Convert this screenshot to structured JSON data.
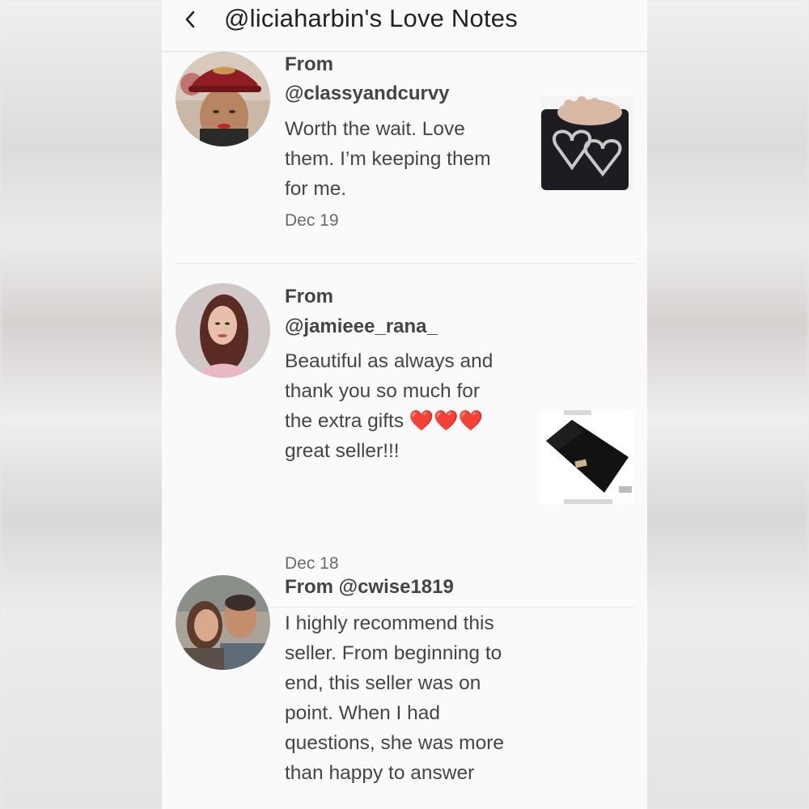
{
  "header": {
    "title": "@liciaharbin's Love Notes",
    "back_icon": "chevron-left-icon"
  },
  "notes": [
    {
      "from_label": "From",
      "username": "@classyandcurvy",
      "text": "Worth the wait. Love them. I’m keeping them for me.",
      "date": "Dec 19",
      "thumbnail": "gloves-with-chain-hearts"
    },
    {
      "from_label": "From",
      "username": "@jamieee_rana_",
      "text": "Beautiful as always and thank you so much for the extra gifts ❤️❤️❤️ great seller!!!",
      "date": "Dec 18",
      "thumbnail": "black-pouch"
    },
    {
      "from_label": "From",
      "username": "@cwise1819",
      "text": "I highly recommend this seller. From beginning to end, this seller was on point. When I had questions, she was more than happy to answer"
    }
  ],
  "colors": {
    "background": "#fafafa",
    "text": "#454545",
    "divider": "#e8e8e8",
    "heart": "#e02424"
  }
}
